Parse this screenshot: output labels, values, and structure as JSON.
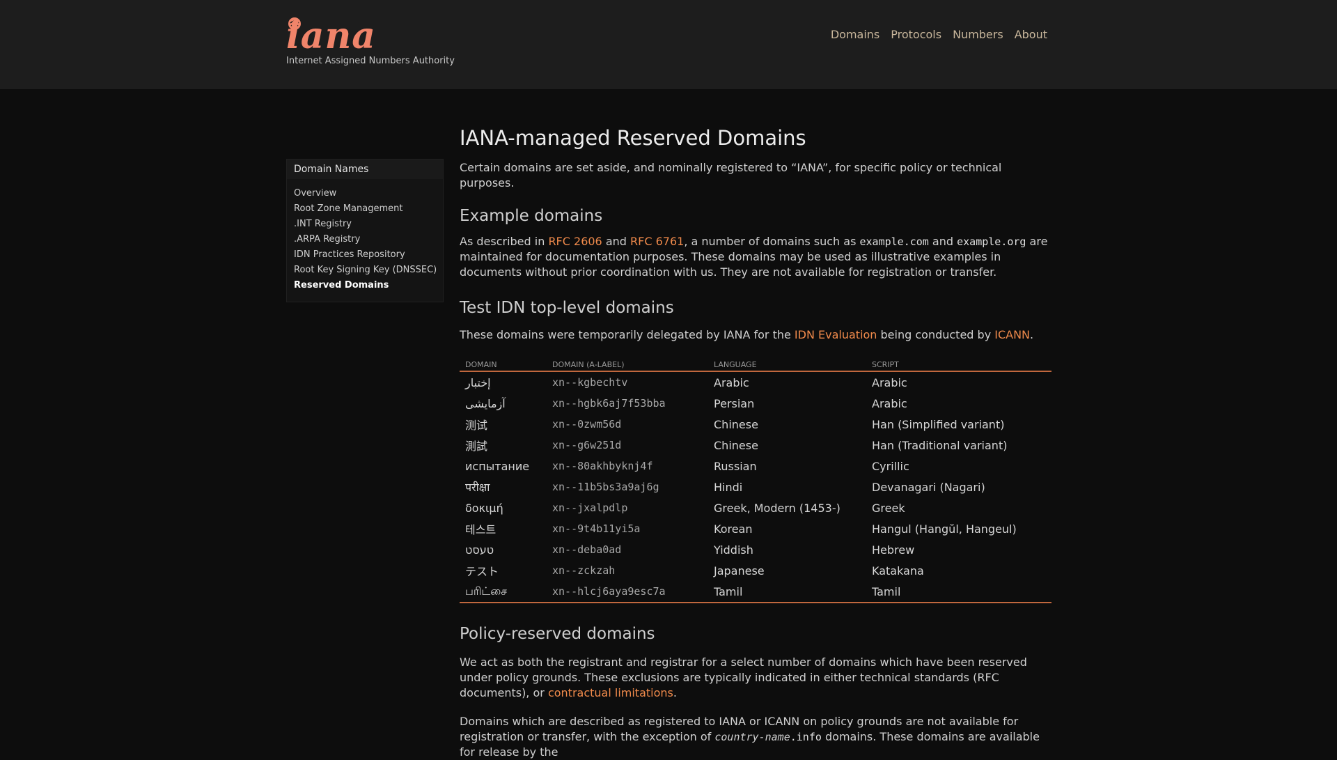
{
  "header": {
    "logo_text": "iana",
    "logo_subtitle": "Internet Assigned Numbers Authority",
    "nav": [
      "Domains",
      "Protocols",
      "Numbers",
      "About"
    ]
  },
  "sidebar": {
    "title": "Domain Names",
    "items": [
      {
        "label": "Overview"
      },
      {
        "label": "Root Zone Management"
      },
      {
        "label": ".INT Registry"
      },
      {
        "label": ".ARPA Registry"
      },
      {
        "label": "IDN Practices Repository"
      },
      {
        "label": "Root Key Signing Key (DNSSEC)"
      },
      {
        "label": "Reserved Domains"
      }
    ]
  },
  "main": {
    "title": "IANA-managed Reserved Domains",
    "intro": "Certain domains are set aside, and nominally registered to “IANA”, for specific policy or technical purposes.",
    "example": {
      "heading": "Example domains",
      "t1": "As described in ",
      "link1": "RFC 2606",
      "t2": " and ",
      "link2": "RFC 6761",
      "t3": ", a number of domains such as ",
      "code1": "example.com",
      "t4": " and ",
      "code2": "example.org",
      "t5": " are maintained for documentation purposes. These domains may be used as illustrative examples in documents without prior coordination with us. They are not available for registration or transfer."
    },
    "idn": {
      "heading": "Test IDN top-level domains",
      "t1": "These domains were temporarily delegated by IANA for the ",
      "link1": "IDN Evaluation",
      "t2": " being conducted by ",
      "link2": "ICANN",
      "t3": ".",
      "columns": [
        "DOMAIN",
        "DOMAIN (A-LABEL)",
        "LANGUAGE",
        "SCRIPT"
      ],
      "rows": [
        {
          "domain": "إختبار",
          "alabel": "xn--kgbechtv",
          "language": "Arabic",
          "script": "Arabic"
        },
        {
          "domain": "آزمایشی",
          "alabel": "xn--hgbk6aj7f53bba",
          "language": "Persian",
          "script": "Arabic"
        },
        {
          "domain": "测试",
          "alabel": "xn--0zwm56d",
          "language": "Chinese",
          "script": "Han (Simplified variant)"
        },
        {
          "domain": "測試",
          "alabel": "xn--g6w251d",
          "language": "Chinese",
          "script": "Han (Traditional variant)"
        },
        {
          "domain": "испытание",
          "alabel": "xn--80akhbyknj4f",
          "language": "Russian",
          "script": "Cyrillic"
        },
        {
          "domain": "परीक्षा",
          "alabel": "xn--11b5bs3a9aj6g",
          "language": "Hindi",
          "script": "Devanagari (Nagari)"
        },
        {
          "domain": "δοκιμή",
          "alabel": "xn--jxalpdlp",
          "language": "Greek, Modern (1453-)",
          "script": "Greek"
        },
        {
          "domain": "테스트",
          "alabel": "xn--9t4b11yi5a",
          "language": "Korean",
          "script": "Hangul (Hangŭl, Hangeul)"
        },
        {
          "domain": "טעסט",
          "alabel": "xn--deba0ad",
          "language": "Yiddish",
          "script": "Hebrew"
        },
        {
          "domain": "テスト",
          "alabel": "xn--zckzah",
          "language": "Japanese",
          "script": "Katakana"
        },
        {
          "domain": "பரிட்சை",
          "alabel": "xn--hlcj6aya9esc7a",
          "language": "Tamil",
          "script": "Tamil"
        }
      ]
    },
    "policy": {
      "heading": "Policy-reserved domains",
      "p1_text": "We act as both the registrant and registrar for a select number of domains which have been reserved under policy grounds. These exclusions are typically indicated in either technical standards (RFC documents), or ",
      "p1_link": "contractual limitations",
      "p1_end": ".",
      "p2_text": "Domains which are described as registered to IANA or ICANN on policy grounds are not available for registration or transfer, with the exception of ",
      "p2_code": "country-name",
      "p2_code2": ".info",
      "p2_end": " domains. These domains are available for release by the"
    }
  },
  "colors": {
    "accent": "#f08a4b",
    "rule": "#c0673d",
    "header_bg": "#1d1d1d",
    "page_bg": "#0d0d0d"
  }
}
